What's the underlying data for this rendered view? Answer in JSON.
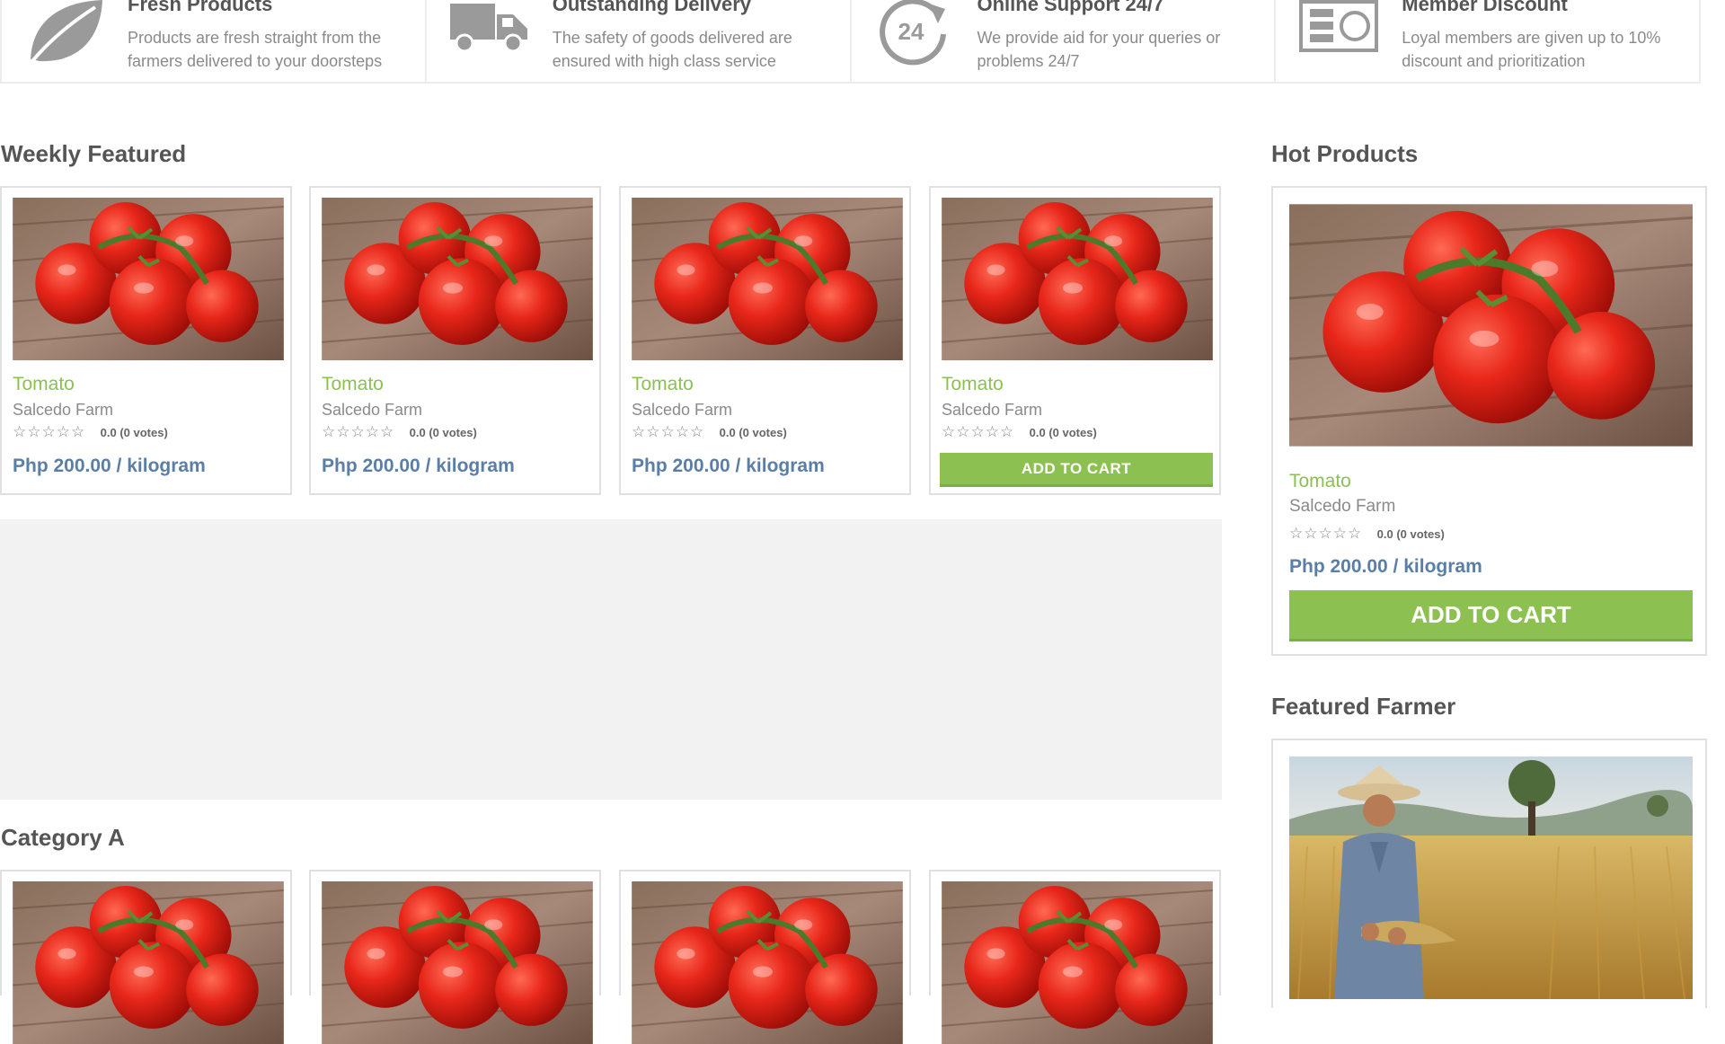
{
  "features": [
    {
      "icon": "leaf-icon",
      "title": "Fresh Products",
      "desc": "Products are fresh straight from the farmers delivered to your doorsteps"
    },
    {
      "icon": "truck-icon",
      "title": "Outstanding Delivery",
      "desc": "The safety of goods delivered are ensured with high class service"
    },
    {
      "icon": "support-24-icon",
      "title": "Online Support 24/7",
      "desc": "We provide aid for your queries or problems 24/7",
      "badge": "24"
    },
    {
      "icon": "member-card-icon",
      "title": "Member Discount",
      "desc": "Loyal members are given up to 10% discount and prioritization"
    }
  ],
  "weekly_featured": {
    "title": "Weekly Featured",
    "products": [
      {
        "name": "Tomato",
        "farm": "Salcedo Farm",
        "stars": "☆☆☆☆☆",
        "rating": "0.0 (0 votes)",
        "price": "Php 200.00 / kilogram"
      },
      {
        "name": "Tomato",
        "farm": "Salcedo Farm",
        "stars": "☆☆☆☆☆",
        "rating": "0.0 (0 votes)",
        "price": "Php 200.00 / kilogram"
      },
      {
        "name": "Tomato",
        "farm": "Salcedo Farm",
        "stars": "☆☆☆☆☆",
        "rating": "0.0 (0 votes)",
        "price": "Php 200.00 / kilogram"
      },
      {
        "name": "Tomato",
        "farm": "Salcedo Farm",
        "stars": "☆☆☆☆☆",
        "rating": "0.0 (0 votes)",
        "cart_label": "ADD TO CART"
      }
    ]
  },
  "category_a": {
    "title": "Category A"
  },
  "hot_products": {
    "title": "Hot Products",
    "product": {
      "name": "Tomato",
      "farm": "Salcedo Farm",
      "stars": "☆☆☆☆☆",
      "rating": "0.0 (0 votes)",
      "price": "Php 200.00 / kilogram",
      "cart_label": "ADD TO CART"
    }
  },
  "featured_farmer": {
    "title": "Featured Farmer"
  },
  "colors": {
    "accent_green": "#8cc152",
    "price_blue": "#5a7fa6",
    "border": "#e0e0e0",
    "placeholder_bg": "#f2f2f2"
  }
}
